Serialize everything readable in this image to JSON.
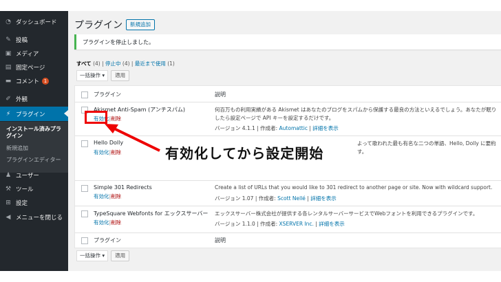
{
  "sidebar": {
    "items": [
      {
        "label": "ダッシュボード",
        "icon": "dashboard-icon"
      },
      {
        "label": "投稿",
        "icon": "pin-icon"
      },
      {
        "label": "メディア",
        "icon": "media-icon"
      },
      {
        "label": "固定ページ",
        "icon": "page-icon"
      },
      {
        "label": "コメント",
        "icon": "comment-icon",
        "badge": "1"
      },
      {
        "label": "外観",
        "icon": "brush-icon"
      },
      {
        "label": "プラグイン",
        "icon": "plugin-icon"
      },
      {
        "label": "ユーザー",
        "icon": "user-icon"
      },
      {
        "label": "ツール",
        "icon": "wrench-icon"
      },
      {
        "label": "設定",
        "icon": "settings-icon"
      },
      {
        "label": "メニューを閉じる",
        "icon": "collapse-icon"
      }
    ],
    "submenu": [
      "インストール済みプラグイン",
      "新規追加",
      "プラグインエディター"
    ]
  },
  "header": {
    "title": "プラグイン",
    "add_new": "新規追加"
  },
  "notice": {
    "text": "プラグインを停止しました。"
  },
  "filters": {
    "all": "すべて",
    "all_count": "(4)",
    "sep1": "|",
    "inactive": "停止中",
    "inactive_count": "(4)",
    "sep2": "|",
    "recent": "最近まで使用",
    "recent_count": "(1)"
  },
  "bulk": {
    "select": "一括操作 ▾",
    "apply": "適用"
  },
  "table": {
    "col_plugin": "プラグイン",
    "col_desc": "説明",
    "rows": [
      {
        "name": "Akismet Anti-Spam (アンチスパム)",
        "activate": "有効化",
        "sep": "|",
        "delete": "削除",
        "desc1": "何百万もの利用実績がある Akismet はあなたのブログをスパムから保護する最良の方法といえるでしょう。あなたが眠り",
        "desc2": "したら設定ページで API キーを設定するだけです。",
        "version": "バージョン 4.1.1",
        "author_label": "作成者:",
        "author": "Automattic",
        "details": "詳細を表示"
      },
      {
        "name": "Hello Dolly",
        "activate": "有効化",
        "sep": "|",
        "delete": "削除",
        "desc1": "よって歌われた最も有名な二つの単語、Hello, Dolly に要約",
        "desc2": "す。",
        "version": "",
        "author_label": "",
        "author": "",
        "details": ""
      },
      {
        "name": "Simple 301 Redirects",
        "activate": "有効化",
        "sep": "|",
        "delete": "削除",
        "desc1": "Create a list of URLs that you would like to 301 redirect to another page or site. Now with wildcard support.",
        "desc2": "",
        "version": "バージョン 1.07",
        "author_label": "作成者:",
        "author": "Scott Nellé",
        "details": "詳細を表示"
      },
      {
        "name": "TypeSquare Webfonts for エックスサーバー",
        "activate": "有効化",
        "sep": "|",
        "delete": "削除",
        "desc1": "エックスサーバー株式会社が提供する各レンタルサーバーサービスでWebフォントを利用できるプラグインです。",
        "desc2": "",
        "version": "バージョン 1.1.0",
        "author_label": "作成者:",
        "author": "XSERVER Inc.",
        "details": "詳細を表示"
      }
    ]
  },
  "callout": {
    "text": "有効化してから設定開始"
  },
  "colors": {
    "sidebar": "#23282d",
    "active": "#0073aa",
    "link": "#0073aa",
    "delete": "#a00000",
    "highlight": "#e00000"
  }
}
